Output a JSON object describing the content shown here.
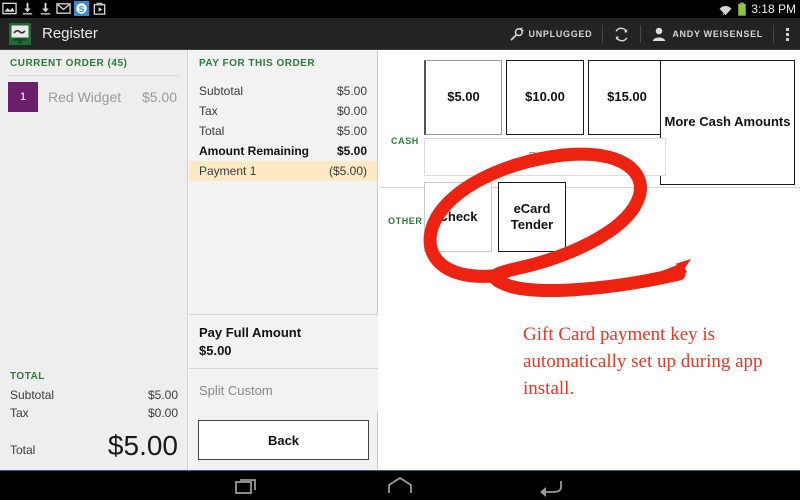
{
  "statusbar": {
    "icons": [
      "image-icon",
      "download-icon",
      "download-icon",
      "mail-icon",
      "dollar-badge-icon",
      "app-install-icon"
    ],
    "wifi_icon": "wifi-icon",
    "battery_icon": "battery-icon",
    "clock": "3:18 PM"
  },
  "actionbar": {
    "app_icon": "cash-register-icon",
    "title": "Register",
    "unplugged_icon": "plug-icon",
    "unplugged_label": "UNPLUGGED",
    "sync_icon": "refresh-icon",
    "user_icon": "person-icon",
    "user_label": "ANDY WEISENSEL",
    "overflow_icon": "overflow-menu-icon"
  },
  "order_panel": {
    "heading": "CURRENT ORDER (45)",
    "lines": [
      {
        "qty": "1",
        "name": "Red Widget",
        "price": "$5.00"
      }
    ],
    "totals_heading": "TOTAL",
    "rows": [
      {
        "label": "Subtotal",
        "value": "$5.00"
      },
      {
        "label": "Tax",
        "value": "$0.00"
      }
    ],
    "grand_label": "Total",
    "grand_value": "$5.00"
  },
  "pay_panel": {
    "heading": "PAY FOR THIS ORDER",
    "rows": [
      {
        "label": "Subtotal",
        "value": "$5.00"
      },
      {
        "label": "Tax",
        "value": "$0.00"
      },
      {
        "label": "Total",
        "value": "$5.00"
      },
      {
        "label": "Amount Remaining",
        "value": "$5.00"
      },
      {
        "label": "Payment 1",
        "value": "($5.00)"
      }
    ],
    "pay_full_title": "Pay Full Amount",
    "pay_full_amount": "$5.00",
    "split_custom": "Split Custom",
    "back_label": "Back"
  },
  "tender_panel": {
    "cash_label": "CASH",
    "cash_buttons": [
      "$5.00",
      "$10.00",
      "$15.00"
    ],
    "more_cash_label": "More Cash Amounts",
    "pay_row_label": "Pay $",
    "other_label": "OTHER",
    "other_buttons": [
      "Check",
      "eCard Tender"
    ]
  },
  "annotation": {
    "circle_color": "#ee2211",
    "text": "Gift Card payment key is automatically set up during app install."
  },
  "navbar": {
    "recent_icon": "recent-apps-icon",
    "home_icon": "home-icon",
    "back_icon": "back-icon"
  },
  "colors": {
    "accent_green": "#2d7a3e",
    "badge_purple": "#6b1f6b",
    "highlight_yellow": "#fdeac4",
    "annotation_red": "#ee3322"
  }
}
